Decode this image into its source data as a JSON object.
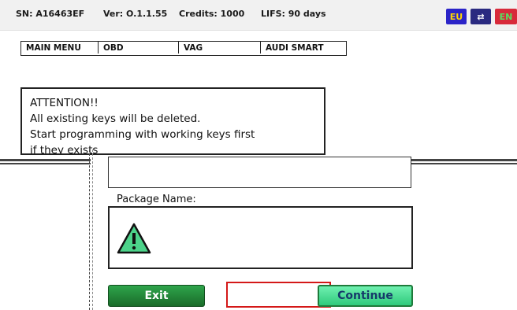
{
  "status": {
    "sn": "SN: A16463EF",
    "ver": "Ver: O.1.1.55",
    "credits": "Credits: 1000",
    "lifs": "LIFS: 90 days",
    "flags": {
      "eu": "EU",
      "usb": "⇄",
      "en": "EN"
    }
  },
  "breadcrumb": [
    "MAIN MENU",
    "OBD",
    "VAG",
    "AUDI SMART"
  ],
  "attention": {
    "title": "ATTENTION!!",
    "lines": [
      "All existing keys will be deleted.",
      "Start programming with working keys first",
      "if they exists"
    ]
  },
  "dialog": {
    "package_label": "Package Name:",
    "exit_label": "Exit",
    "continue_label": "Continue"
  },
  "colors": {
    "warning_fill": "#4cd38a",
    "exit_button": "#1f8a35",
    "continue_button": "#45de92",
    "highlight": "#d41818"
  }
}
